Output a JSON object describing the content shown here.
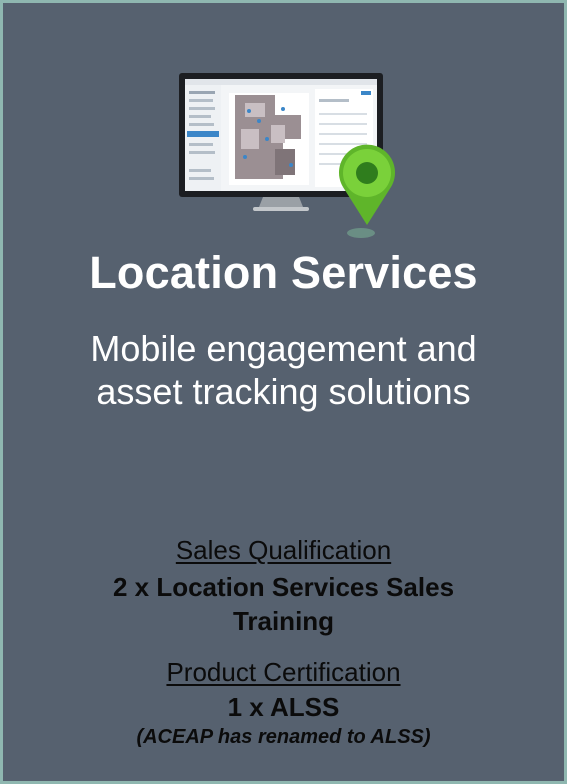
{
  "colors": {
    "background": "#56616f",
    "border": "#8fb7b0",
    "title": "#ffffff",
    "body_text": "#0b0b0b",
    "pin": "#6cc42b"
  },
  "illustration": {
    "monitor_icon": "monitor-floor-map-icon",
    "pin_icon": "location-pin-icon"
  },
  "title": "Location Services",
  "subtitle_line1": "Mobile engagement and",
  "subtitle_line2": "asset tracking solutions",
  "sales_qualification": {
    "heading": "Sales Qualification",
    "requirement_line1": "2 x Location Services Sales",
    "requirement_line2": "Training"
  },
  "product_certification": {
    "heading": "Product Certification",
    "requirement": "1 x ALSS",
    "note": "(ACEAP has renamed to ALSS)"
  }
}
